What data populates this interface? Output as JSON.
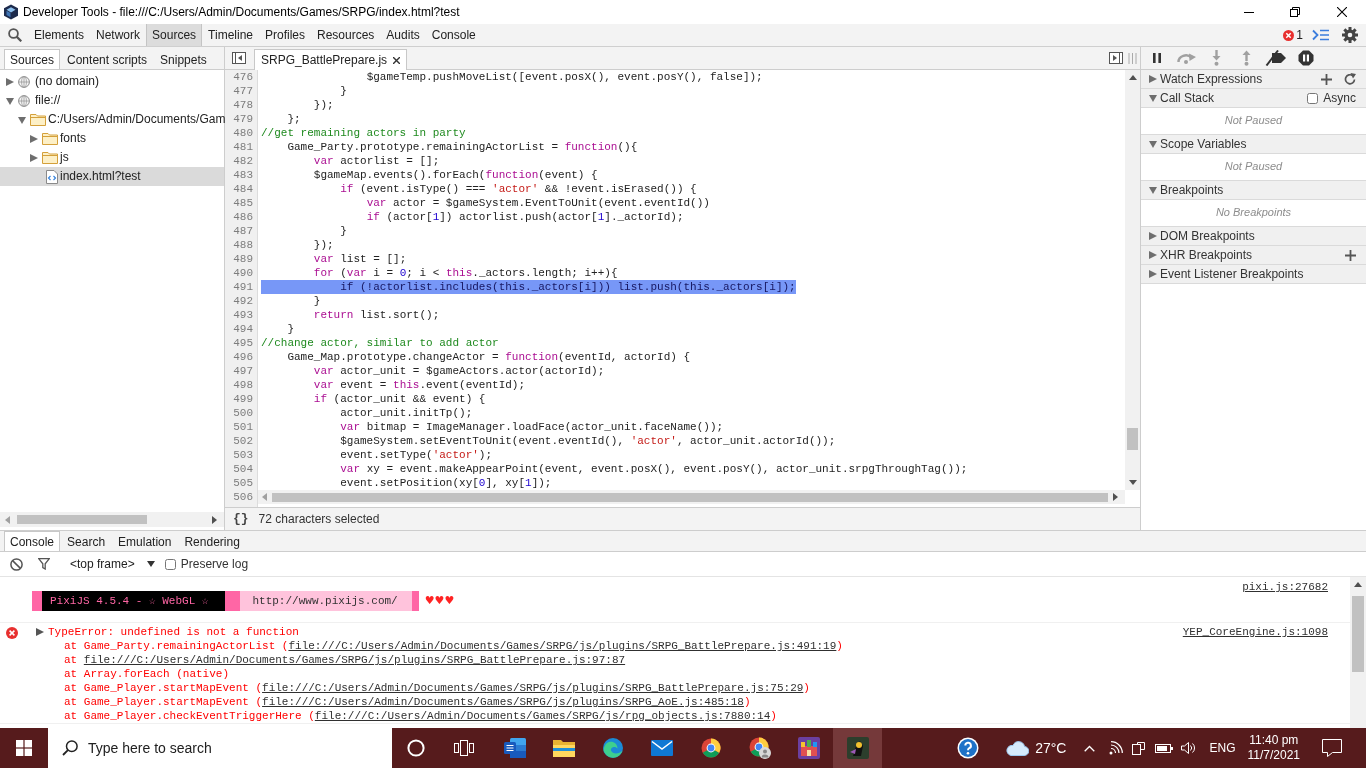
{
  "window": {
    "title": "Developer Tools - file:///C:/Users/Admin/Documents/Games/SRPG/index.html?test"
  },
  "toolbar": {
    "tabs": [
      {
        "label": "Elements",
        "selected": false
      },
      {
        "label": "Network",
        "selected": false
      },
      {
        "label": "Sources",
        "selected": true
      },
      {
        "label": "Timeline",
        "selected": false
      },
      {
        "label": "Profiles",
        "selected": false
      },
      {
        "label": "Resources",
        "selected": false
      },
      {
        "label": "Audits",
        "selected": false
      },
      {
        "label": "Console",
        "selected": false
      }
    ],
    "error_count": "1"
  },
  "navigator": {
    "tabs": [
      {
        "label": "Sources",
        "selected": true
      },
      {
        "label": "Content scripts",
        "selected": false
      },
      {
        "label": "Snippets",
        "selected": false
      }
    ],
    "tree": [
      {
        "kind": "domain",
        "label": "(no domain)",
        "expanded": false,
        "selected": false
      },
      {
        "kind": "domain",
        "label": "file://",
        "expanded": true,
        "selected": false,
        "children": [
          {
            "kind": "folder",
            "label": "C:/Users/Admin/Documents/Gam",
            "expanded": true,
            "selected": false,
            "children": [
              {
                "kind": "folder",
                "label": "fonts",
                "expanded": false,
                "selected": false
              },
              {
                "kind": "folder",
                "label": "js",
                "expanded": false,
                "selected": false
              },
              {
                "kind": "file",
                "label": "index.html?test",
                "selected": true
              }
            ]
          }
        ]
      }
    ]
  },
  "editor": {
    "tabs": [
      {
        "label": "SRPG_BattlePrepare.js",
        "selected": true
      }
    ],
    "lines": [
      {
        "number": "476",
        "selected": false,
        "tokens": [
          {
            "kind": "plain",
            "text": "                $gameTemp.pushMoveList([event.posX(), event.posY(), false]);"
          }
        ]
      },
      {
        "number": "477",
        "selected": false,
        "tokens": [
          {
            "kind": "plain",
            "text": "            }"
          }
        ]
      },
      {
        "number": "478",
        "selected": false,
        "tokens": [
          {
            "kind": "plain",
            "text": "        });"
          }
        ]
      },
      {
        "number": "479",
        "selected": false,
        "tokens": [
          {
            "kind": "plain",
            "text": "    };"
          }
        ]
      },
      {
        "number": "480",
        "selected": false,
        "tokens": [
          {
            "kind": "comment",
            "text": "//get remaining actors in party"
          }
        ]
      },
      {
        "number": "481",
        "selected": false,
        "tokens": [
          {
            "kind": "plain",
            "text": "    Game_Party.prototype.remainingActorList = "
          },
          {
            "kind": "keyword",
            "text": "function"
          },
          {
            "kind": "plain",
            "text": "(){"
          }
        ]
      },
      {
        "number": "482",
        "selected": false,
        "tokens": [
          {
            "kind": "keyword",
            "text": "        var"
          },
          {
            "kind": "plain",
            "text": " actorlist = [];"
          }
        ]
      },
      {
        "number": "483",
        "selected": false,
        "tokens": [
          {
            "kind": "plain",
            "text": "        $gameMap.events().forEach("
          },
          {
            "kind": "keyword",
            "text": "function"
          },
          {
            "kind": "plain",
            "text": "(event) {"
          }
        ]
      },
      {
        "number": "484",
        "selected": false,
        "tokens": [
          {
            "kind": "keyword",
            "text": "            if"
          },
          {
            "kind": "plain",
            "text": " (event.isType() === "
          },
          {
            "kind": "string",
            "text": "'actor'"
          },
          {
            "kind": "plain",
            "text": " && !event.isErased()) {"
          }
        ]
      },
      {
        "number": "485",
        "selected": false,
        "tokens": [
          {
            "kind": "keyword",
            "text": "                var"
          },
          {
            "kind": "plain",
            "text": " actor = $gameSystem.EventToUnit(event.eventId())"
          }
        ]
      },
      {
        "number": "486",
        "selected": false,
        "tokens": [
          {
            "kind": "keyword",
            "text": "                if"
          },
          {
            "kind": "plain",
            "text": " (actor["
          },
          {
            "kind": "number",
            "text": "1"
          },
          {
            "kind": "plain",
            "text": "]) actorlist.push(actor["
          },
          {
            "kind": "number",
            "text": "1"
          },
          {
            "kind": "plain",
            "text": "]._actorId);"
          }
        ]
      },
      {
        "number": "487",
        "selected": false,
        "tokens": [
          {
            "kind": "plain",
            "text": "            }"
          }
        ]
      },
      {
        "number": "488",
        "selected": false,
        "tokens": [
          {
            "kind": "plain",
            "text": "        });"
          }
        ]
      },
      {
        "number": "489",
        "selected": false,
        "tokens": [
          {
            "kind": "keyword",
            "text": "        var"
          },
          {
            "kind": "plain",
            "text": " list = [];"
          }
        ]
      },
      {
        "number": "490",
        "selected": false,
        "tokens": [
          {
            "kind": "keyword",
            "text": "        for"
          },
          {
            "kind": "plain",
            "text": " ("
          },
          {
            "kind": "keyword",
            "text": "var"
          },
          {
            "kind": "plain",
            "text": " i = "
          },
          {
            "kind": "number",
            "text": "0"
          },
          {
            "kind": "plain",
            "text": "; i < "
          },
          {
            "kind": "keyword",
            "text": "this"
          },
          {
            "kind": "plain",
            "text": "._actors.length; i++){"
          }
        ]
      },
      {
        "number": "491",
        "selected": true,
        "tokens": [
          {
            "kind": "plain",
            "text": "            if (!actorlist.includes(this._actors[i])) list.push(this._actors[i]);"
          }
        ]
      },
      {
        "number": "492",
        "selected": false,
        "tokens": [
          {
            "kind": "plain",
            "text": "        }"
          }
        ]
      },
      {
        "number": "493",
        "selected": false,
        "tokens": [
          {
            "kind": "keyword",
            "text": "        return"
          },
          {
            "kind": "plain",
            "text": " list.sort();"
          }
        ]
      },
      {
        "number": "494",
        "selected": false,
        "tokens": [
          {
            "kind": "plain",
            "text": "    }"
          }
        ]
      },
      {
        "number": "495",
        "selected": false,
        "tokens": [
          {
            "kind": "comment",
            "text": "//change actor, similar to add actor"
          }
        ]
      },
      {
        "number": "496",
        "selected": false,
        "tokens": [
          {
            "kind": "plain",
            "text": "    Game_Map.prototype.changeActor = "
          },
          {
            "kind": "keyword",
            "text": "function"
          },
          {
            "kind": "plain",
            "text": "(eventId, actorId) {"
          }
        ]
      },
      {
        "number": "497",
        "selected": false,
        "tokens": [
          {
            "kind": "keyword",
            "text": "        var"
          },
          {
            "kind": "plain",
            "text": " actor_unit = $gameActors.actor(actorId);"
          }
        ]
      },
      {
        "number": "498",
        "selected": false,
        "tokens": [
          {
            "kind": "keyword",
            "text": "        var"
          },
          {
            "kind": "plain",
            "text": " event = "
          },
          {
            "kind": "keyword",
            "text": "this"
          },
          {
            "kind": "plain",
            "text": ".event(eventId);"
          }
        ]
      },
      {
        "number": "499",
        "selected": false,
        "tokens": [
          {
            "kind": "keyword",
            "text": "        if"
          },
          {
            "kind": "plain",
            "text": " (actor_unit && event) {"
          }
        ]
      },
      {
        "number": "500",
        "selected": false,
        "tokens": [
          {
            "kind": "plain",
            "text": "            actor_unit.initTp();"
          }
        ]
      },
      {
        "number": "501",
        "selected": false,
        "tokens": [
          {
            "kind": "keyword",
            "text": "            var"
          },
          {
            "kind": "plain",
            "text": " bitmap = ImageManager.loadFace(actor_unit.faceName());"
          }
        ]
      },
      {
        "number": "502",
        "selected": false,
        "tokens": [
          {
            "kind": "plain",
            "text": "            $gameSystem.setEventToUnit(event.eventId(), "
          },
          {
            "kind": "string",
            "text": "'actor'"
          },
          {
            "kind": "plain",
            "text": ", actor_unit.actorId());"
          }
        ]
      },
      {
        "number": "503",
        "selected": false,
        "tokens": [
          {
            "kind": "plain",
            "text": "            event.setType("
          },
          {
            "kind": "string",
            "text": "'actor'"
          },
          {
            "kind": "plain",
            "text": ");"
          }
        ]
      },
      {
        "number": "504",
        "selected": false,
        "tokens": [
          {
            "kind": "keyword",
            "text": "            var"
          },
          {
            "kind": "plain",
            "text": " xy = event.makeAppearPoint(event, event.posX(), event.posY(), actor_unit.srpgThroughTag());"
          }
        ]
      },
      {
        "number": "505",
        "selected": false,
        "tokens": [
          {
            "kind": "plain",
            "text": "            event.setPosition(xy["
          },
          {
            "kind": "number",
            "text": "0"
          },
          {
            "kind": "plain",
            "text": "], xy["
          },
          {
            "kind": "number",
            "text": "1"
          },
          {
            "kind": "plain",
            "text": "]);"
          }
        ]
      },
      {
        "number": "506"
      }
    ],
    "format_button": "{}",
    "status": "72 characters selected"
  },
  "sidebar": {
    "sections": [
      {
        "kind": "watch",
        "title": "Watch Expressions",
        "expanded": false
      },
      {
        "kind": "callstack",
        "title": "Call Stack",
        "expanded": true,
        "option": {
          "label": "Async",
          "checked": false
        },
        "message": "Not Paused"
      },
      {
        "kind": "plain",
        "title": "Scope Variables",
        "expanded": true,
        "message": "Not Paused"
      },
      {
        "kind": "plain",
        "title": "Breakpoints",
        "expanded": true,
        "message": "No Breakpoints"
      },
      {
        "kind": "plain",
        "title": "DOM Breakpoints",
        "expanded": false
      },
      {
        "kind": "xhr",
        "title": "XHR Breakpoints",
        "expanded": false
      },
      {
        "kind": "plain",
        "title": "Event Listener Breakpoints",
        "expanded": false
      }
    ]
  },
  "drawer": {
    "tabs": [
      {
        "label": "Console",
        "selected": true
      },
      {
        "label": "Search",
        "selected": false
      },
      {
        "label": "Emulation",
        "selected": false
      },
      {
        "label": "Rendering",
        "selected": false
      }
    ],
    "frame": "<top frame>",
    "preserve_log": {
      "label": "Preserve log",
      "checked": false
    },
    "messages": [
      {
        "kind": "banner",
        "parts": [
          {
            "kind": "title",
            "text": "PixiJS 4.5.4 - ☆ WebGL ☆"
          },
          {
            "kind": "url",
            "text": "http://www.pixijs.com/"
          }
        ],
        "suffix": "♥♥♥",
        "source": "pixi.js:27682"
      },
      {
        "kind": "error",
        "expanded": false,
        "text": "TypeError: undefined is not a function",
        "source": "YEP_CoreEngine.js:1098",
        "stack": [
          {
            "prefix": "at Game_Party.remainingActorList (",
            "link": "file:///C:/Users/Admin/Documents/Games/SRPG/js/plugins/SRPG_BattlePrepare.js:491:19",
            "suffix": ")"
          },
          {
            "prefix": "at ",
            "link": "file:///C:/Users/Admin/Documents/Games/SRPG/js/plugins/SRPG_BattlePrepare.js:97:87"
          },
          {
            "prefix": "at Array.forEach (native)"
          },
          {
            "prefix": "at Game_Player.startMapEvent (",
            "link": "file:///C:/Users/Admin/Documents/Games/SRPG/js/plugins/SRPG_BattlePrepare.js:75:29",
            "suffix": ")"
          },
          {
            "prefix": "at Game_Player.startMapEvent (",
            "link": "file:///C:/Users/Admin/Documents/Games/SRPG/js/plugins/SRPG_AoE.js:485:18",
            "suffix": ")"
          },
          {
            "prefix": "at Game_Player.checkEventTriggerHere (",
            "link": "file:///C:/Users/Admin/Documents/Games/SRPG/js/rpg_objects.js:7880:14",
            "suffix": ")"
          }
        ]
      }
    ]
  },
  "taskbar": {
    "search_placeholder": "Type here to search",
    "apps": [
      {
        "kind": "word",
        "active": false
      },
      {
        "kind": "explorer",
        "active": false
      },
      {
        "kind": "edge",
        "active": false
      },
      {
        "kind": "mail",
        "active": false
      },
      {
        "kind": "chrome",
        "active": false
      },
      {
        "kind": "chromeprofile",
        "active": false
      },
      {
        "kind": "castle",
        "active": false
      },
      {
        "kind": "character",
        "active": true
      }
    ],
    "temperature": "27°C",
    "language": "ENG",
    "time": "11:40 pm",
    "date": "11/7/2021"
  }
}
